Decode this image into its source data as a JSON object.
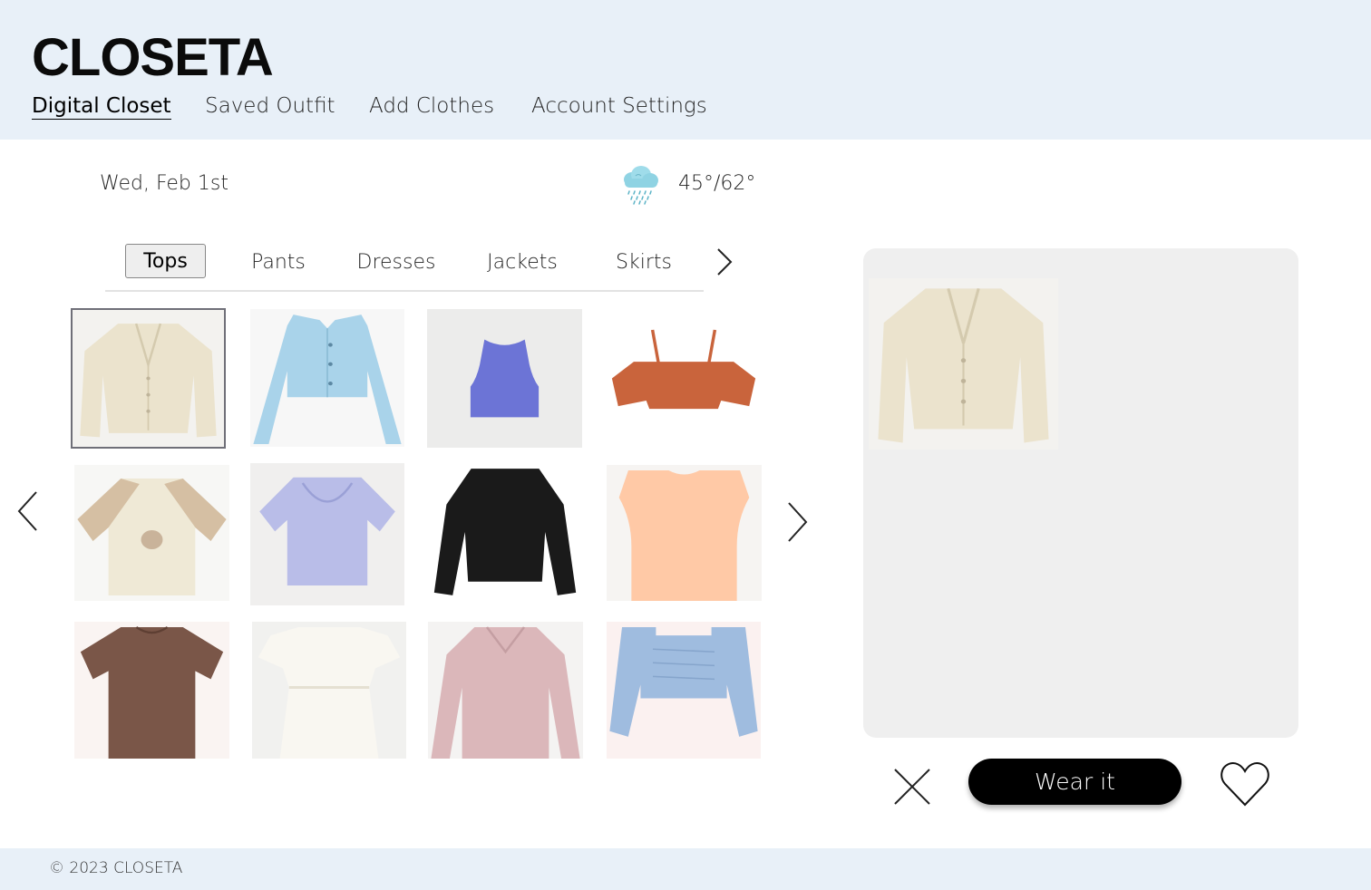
{
  "app": {
    "logo": "CLOSETA"
  },
  "nav": {
    "items": [
      {
        "label": "Digital Closet",
        "active": true
      },
      {
        "label": "Saved Outfit"
      },
      {
        "label": "Add Clothes"
      },
      {
        "label": "Account Settings"
      }
    ]
  },
  "info": {
    "date": "Wed, Feb 1st",
    "temperature": "45°/62°",
    "weather_icon": "rain-cloud-icon"
  },
  "categories": {
    "tabs": [
      {
        "label": "Tops",
        "active": true
      },
      {
        "label": "Pants"
      },
      {
        "label": "Dresses"
      },
      {
        "label": "Jackets"
      },
      {
        "label": "Skirts"
      }
    ]
  },
  "closet_items": [
    {
      "name": "cream-cardigan",
      "color": "#ebe3cd",
      "selected": true
    },
    {
      "name": "light-blue-crop-shirt",
      "color": "#a9d3ea"
    },
    {
      "name": "purple-tank-top",
      "color": "#6c74d6"
    },
    {
      "name": "rust-off-shoulder-top",
      "color": "#c9643c"
    },
    {
      "name": "raglan-mushroom-tee",
      "color": "#e6d6bd"
    },
    {
      "name": "lavender-sweetheart-top",
      "color": "#b9bde8"
    },
    {
      "name": "black-blouse",
      "color": "#1a1a1a"
    },
    {
      "name": "peach-muscle-tank",
      "color": "#ffc9a6"
    },
    {
      "name": "brown-tee",
      "color": "#7a5648"
    },
    {
      "name": "white-peplum-top",
      "color": "#f6f3ea"
    },
    {
      "name": "pink-polo-sweater",
      "color": "#dbb7ba"
    },
    {
      "name": "blue-ruched-crop-top",
      "color": "#9fbcdf"
    }
  ],
  "actions": {
    "wear_label": "Wear it"
  },
  "footer": {
    "copyright": "© 2023 CLOSETA"
  }
}
